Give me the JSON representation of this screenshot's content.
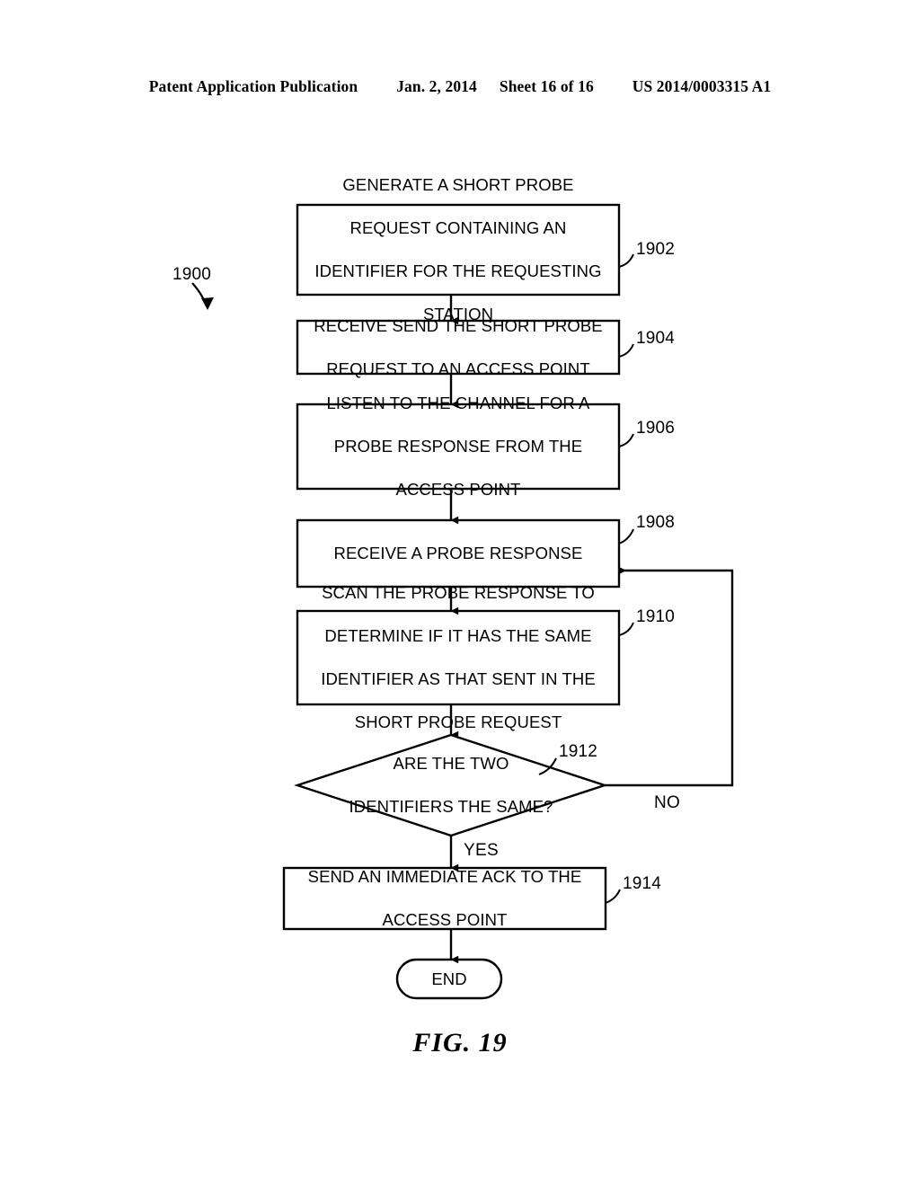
{
  "header": {
    "publication": "Patent Application Publication",
    "date": "Jan. 2, 2014",
    "sheet": "Sheet 16 of 16",
    "patent_number": "US 2014/0003315 A1"
  },
  "figure": {
    "caption": "FIG. 19",
    "flow_label": "1900",
    "nodes": [
      {
        "id": "1902",
        "ref": "1902",
        "shape": "process",
        "lines": [
          "GENERATE A SHORT PROBE",
          "REQUEST CONTAINING AN",
          "IDENTIFIER FOR THE REQUESTING",
          "STATION"
        ]
      },
      {
        "id": "1904",
        "ref": "1904",
        "shape": "process",
        "lines": [
          "RECEIVE SEND THE SHORT PROBE",
          "REQUEST TO AN ACCESS POINT"
        ]
      },
      {
        "id": "1906",
        "ref": "1906",
        "shape": "process",
        "lines": [
          "LISTEN TO THE CHANNEL FOR A",
          "PROBE RESPONSE FROM THE",
          "ACCESS POINT"
        ]
      },
      {
        "id": "1908",
        "ref": "1908",
        "shape": "process",
        "lines": [
          "RECEIVE A PROBE RESPONSE"
        ]
      },
      {
        "id": "1910",
        "ref": "1910",
        "shape": "process",
        "lines": [
          "SCAN THE PROBE RESPONSE TO",
          "DETERMINE IF IT HAS THE SAME",
          "IDENTIFIER AS THAT SENT IN THE",
          "SHORT PROBE REQUEST"
        ]
      },
      {
        "id": "1912",
        "ref": "1912",
        "shape": "decision",
        "lines": [
          "ARE THE TWO",
          "IDENTIFIERS THE SAME?"
        ]
      },
      {
        "id": "1914",
        "ref": "1914",
        "shape": "process",
        "lines": [
          "SEND AN IMMEDIATE ACK TO THE",
          "ACCESS POINT"
        ]
      },
      {
        "id": "end",
        "ref": "",
        "shape": "terminator",
        "lines": [
          "END"
        ]
      }
    ],
    "branches": {
      "yes": "YES",
      "no": "NO"
    }
  },
  "colors": {
    "ink": "#000000",
    "paper": "#ffffff"
  }
}
